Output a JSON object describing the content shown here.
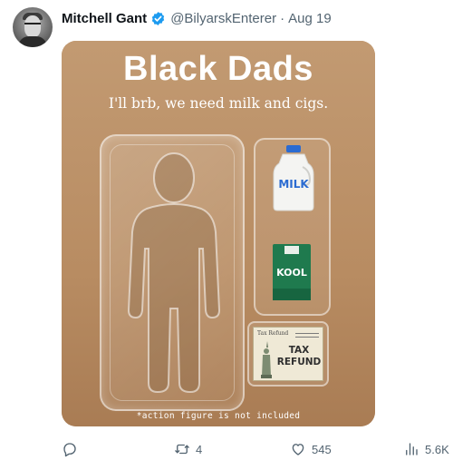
{
  "tweet": {
    "author_name": "Mitchell Gant",
    "verified": true,
    "handle": "@BilyarskEnterer",
    "separator": "·",
    "date": "Aug 19"
  },
  "image": {
    "title": "Black Dads",
    "subtitle": "I'll brb, we need milk and cigs.",
    "milk_label": "MILK",
    "cigs_label": "KOOL",
    "tax_header": "Tax Refund",
    "tax_label_line1": "TAX",
    "tax_label_line2": "REFUND",
    "footnote": "*action figure is not included"
  },
  "actions": {
    "reply": {
      "icon": "reply-icon",
      "count": ""
    },
    "retweet": {
      "icon": "retweet-icon",
      "count": "4"
    },
    "like": {
      "icon": "heart-icon",
      "count": "545"
    },
    "views": {
      "icon": "views-icon",
      "count": "5.6K"
    }
  },
  "colors": {
    "verified_blue": "#1d9bf0",
    "muted_text": "#536471",
    "cardboard": "#b98f66"
  }
}
